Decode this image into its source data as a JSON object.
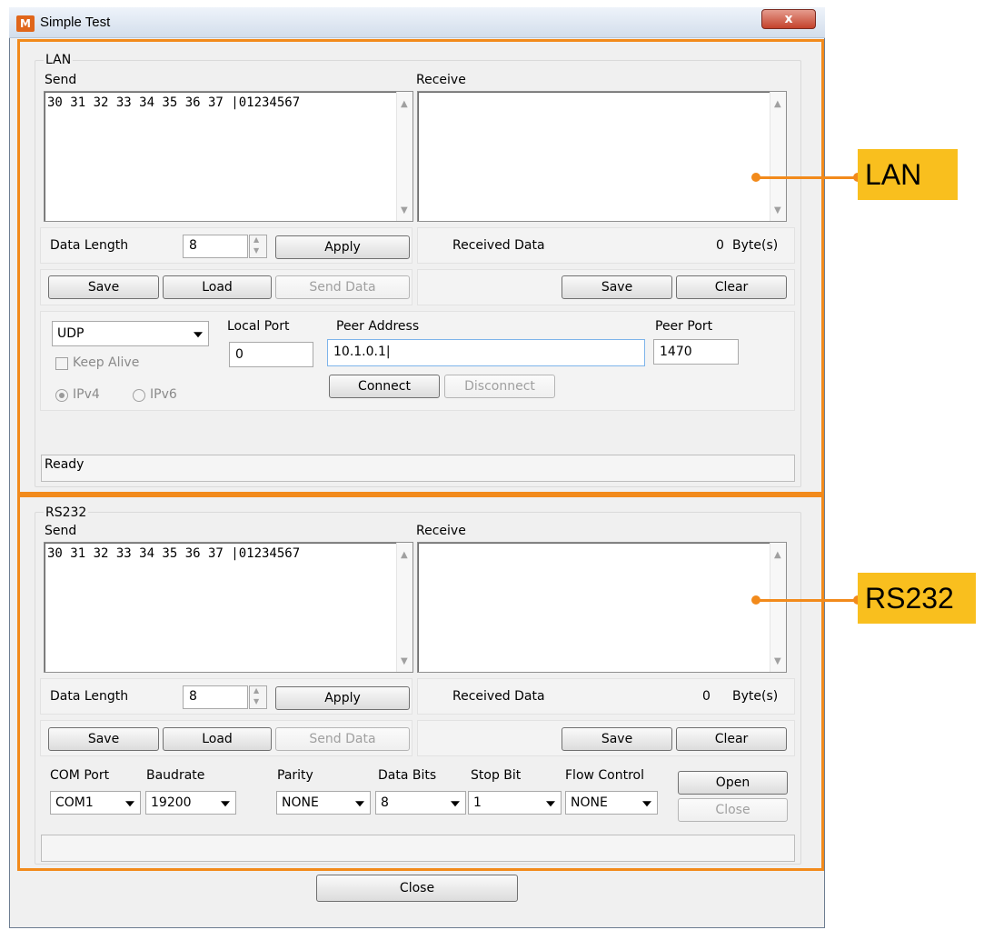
{
  "window": {
    "title": "Simple Test",
    "close_glyph": "x"
  },
  "lan": {
    "group_label": "LAN",
    "send_label": "Send",
    "receive_label": "Receive",
    "send_text": "30 31 32 33 34 35 36 37 |01234567",
    "receive_text": "",
    "data_length_label": "Data Length",
    "data_length_value": "8",
    "apply_label": "Apply",
    "received_data_label": "Received Data",
    "received_count": "0",
    "bytes_unit": "Byte(s)",
    "save_label": "Save",
    "load_label": "Load",
    "send_data_label": "Send Data",
    "recv_save_label": "Save",
    "clear_label": "Clear",
    "protocol": "UDP",
    "keep_alive_label": "Keep Alive",
    "ipv4_label": "IPv4",
    "ipv6_label": "IPv6",
    "local_port_label": "Local Port",
    "local_port_value": "0",
    "peer_address_label": "Peer Address",
    "peer_address_value": "10.1.0.1|",
    "peer_port_label": "Peer Port",
    "peer_port_value": "1470",
    "connect_label": "Connect",
    "disconnect_label": "Disconnect",
    "status": "Ready"
  },
  "rs232": {
    "group_label": "RS232",
    "send_label": "Send",
    "receive_label": "Receive",
    "send_text": "30 31 32 33 34 35 36 37 |01234567",
    "receive_text": "",
    "data_length_label": "Data Length",
    "data_length_value": "8",
    "apply_label": "Apply",
    "received_data_label": "Received Data",
    "received_count": "0",
    "bytes_unit": "Byte(s)",
    "save_label": "Save",
    "load_label": "Load",
    "send_data_label": "Send Data",
    "recv_save_label": "Save",
    "clear_label": "Clear",
    "com_port_label": "COM Port",
    "com_port_value": "COM1",
    "baudrate_label": "Baudrate",
    "baudrate_value": "19200",
    "parity_label": "Parity",
    "parity_value": "NONE",
    "data_bits_label": "Data Bits",
    "data_bits_value": "8",
    "stop_bit_label": "Stop Bit",
    "stop_bit_value": "1",
    "flow_control_label": "Flow Control",
    "flow_control_value": "NONE",
    "open_label": "Open",
    "close_port_label": "Close",
    "status": ""
  },
  "footer": {
    "close_label": "Close"
  },
  "callouts": {
    "lan": "LAN",
    "rs232": "RS232"
  },
  "colors": {
    "highlight": "#f28a1b",
    "callout_fill": "#f9bf1e"
  }
}
